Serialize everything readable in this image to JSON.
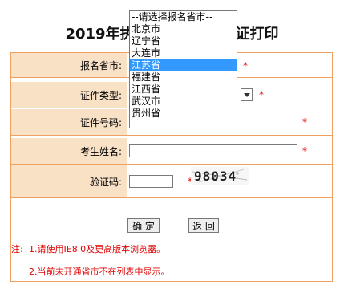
{
  "page_title": "2019年执业药师考试准考证打印",
  "form": {
    "province_label": "报名省市:",
    "id_type_label": "证件类型:",
    "id_number_label": "证件号码:",
    "name_label": "考生姓名:",
    "captcha_label": "验证码:",
    "required_mark": "*",
    "captcha_text": "98034",
    "confirm_label": "确 定",
    "back_label": "返 回",
    "note_prefix": "注:",
    "notes": [
      "1.请使用IE8.0及更高版本浏览器。",
      "2.当前未开通省市不在列表中显示。"
    ]
  },
  "province_dropdown": {
    "options": [
      "--请选择报名省市--",
      "北京市",
      "辽宁省",
      "大连市",
      "江苏省",
      "福建省",
      "江西省",
      "武汉市",
      "贵州省"
    ],
    "selected_index": 4
  },
  "colors": {
    "label_bg": "#f9e1c6",
    "border": "#f0a060",
    "required": "#e00000",
    "selected_option_bg": "#3399ff"
  }
}
